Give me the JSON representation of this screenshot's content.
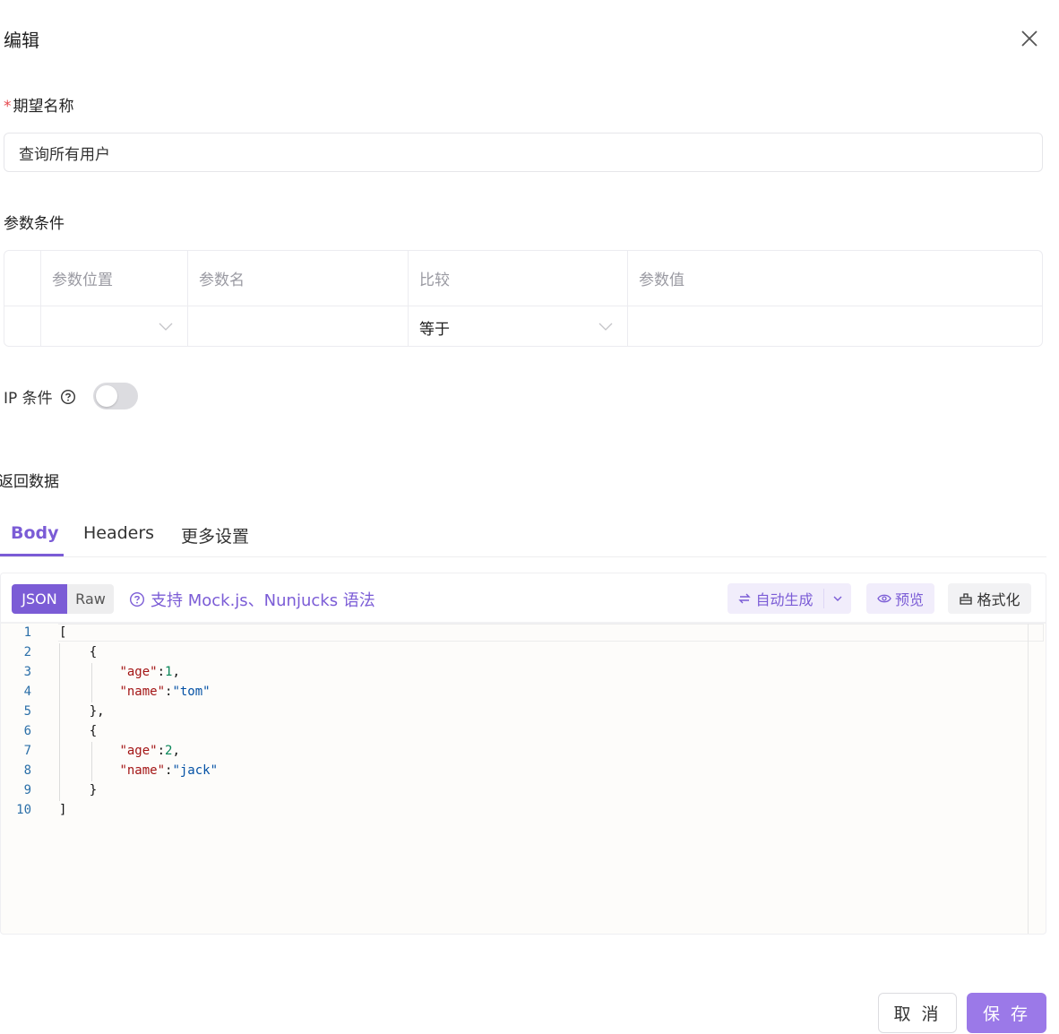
{
  "dialog": {
    "title": "编辑"
  },
  "form": {
    "name_label": "期望名称",
    "name_value": "查询所有用户",
    "param_section_label": "参数条件",
    "param_table": {
      "headers": [
        "参数位置",
        "参数名",
        "比较",
        "参数值"
      ],
      "row": {
        "location": "",
        "name": "",
        "compare": "等于",
        "value": ""
      }
    },
    "ip_label": "IP 条件",
    "ip_enabled": false,
    "response_section_label": "返回数据"
  },
  "tabs": [
    "Body",
    "Headers",
    "更多设置"
  ],
  "active_tab": "Body",
  "editor": {
    "mode_json": "JSON",
    "mode_raw": "Raw",
    "mock_tip": "支持 Mock.js、Nunjucks 语法",
    "auto_generate": "自动生成",
    "preview": "预览",
    "format": "格式化",
    "line_numbers": [
      "1",
      "2",
      "3",
      "4",
      "5",
      "6",
      "7",
      "8",
      "9",
      "10"
    ]
  },
  "footer": {
    "cancel": "取 消",
    "save": "保 存"
  },
  "colors": {
    "accent": "#7b5cd6",
    "required": "#e5484d",
    "save_bg": "#9b79e8"
  }
}
